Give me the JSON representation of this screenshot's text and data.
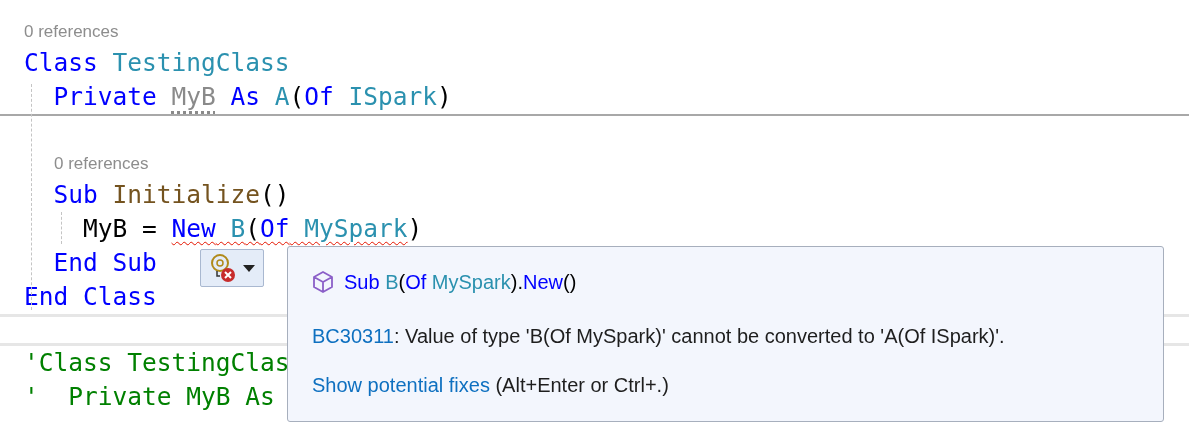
{
  "editor": {
    "blocks": [
      {
        "lines": [
          {
            "kind": "codelens",
            "text": "0 references",
            "indented": false
          },
          {
            "kind": "code",
            "tokens": [
              {
                "text": "Class",
                "kind": "keyword"
              },
              {
                "text": " TestingClass",
                "kind": "type"
              }
            ]
          },
          {
            "kind": "code",
            "tokens": [
              {
                "text": "  Private ",
                "kind": "keyword"
              },
              {
                "text": "MyB",
                "kind": "unused",
                "hint": true
              },
              {
                "text": " As",
                "kind": "keyword"
              },
              {
                "text": " A",
                "kind": "type"
              },
              {
                "text": "(",
                "kind": "plain"
              },
              {
                "text": "Of",
                "kind": "keyword"
              },
              {
                "text": " ISpark",
                "kind": "type"
              },
              {
                "text": ")",
                "kind": "plain"
              }
            ]
          }
        ]
      },
      {
        "lines": [
          {
            "kind": "blank"
          },
          {
            "kind": "codelens",
            "text": "0 references",
            "indented": true
          },
          {
            "kind": "code",
            "tokens": [
              {
                "text": "  Sub",
                "kind": "keyword"
              },
              {
                "text": " Initialize",
                "kind": "method"
              },
              {
                "text": "()",
                "kind": "plain"
              }
            ]
          },
          {
            "kind": "code",
            "tokens": [
              {
                "text": "    MyB = ",
                "kind": "plain"
              },
              {
                "text": "New",
                "kind": "keyword",
                "error": true
              },
              {
                "text": " B",
                "kind": "type",
                "error": true
              },
              {
                "text": "(",
                "kind": "plain",
                "error": true
              },
              {
                "text": "Of",
                "kind": "keyword",
                "error": true
              },
              {
                "text": " MySpark",
                "kind": "type",
                "error": true
              },
              {
                "text": ")",
                "kind": "plain"
              }
            ]
          },
          {
            "kind": "code",
            "tokens": [
              {
                "text": "  End Sub",
                "kind": "keyword"
              }
            ]
          },
          {
            "kind": "code",
            "tokens": [
              {
                "text": "End Class",
                "kind": "keyword"
              }
            ]
          }
        ]
      },
      {
        "lines": [
          {
            "kind": "code",
            "tokens": [
              {
                "text": "'Class TestingClas",
                "kind": "comment"
              }
            ]
          },
          {
            "kind": "code",
            "tokens": [
              {
                "text": "'  Private MyB As",
                "kind": "comment"
              }
            ]
          }
        ]
      }
    ]
  },
  "quick_actions": {
    "tooltip": {
      "signature": [
        {
          "text": "Sub",
          "kind": "keyword"
        },
        {
          "text": " B",
          "kind": "type"
        },
        {
          "text": "(",
          "kind": "plain"
        },
        {
          "text": "Of",
          "kind": "keyword"
        },
        {
          "text": " MySpark",
          "kind": "type"
        },
        {
          "text": ").",
          "kind": "plain"
        },
        {
          "text": "New",
          "kind": "keyword"
        },
        {
          "text": "()",
          "kind": "plain"
        }
      ],
      "error": {
        "code": "BC30311",
        "message": ": Value of type 'B(Of MySpark)' cannot be converted to 'A(Of ISpark)'."
      },
      "fix": {
        "link": "Show potential fixes",
        "shortcut": " (Alt+Enter or Ctrl+.)"
      }
    }
  }
}
